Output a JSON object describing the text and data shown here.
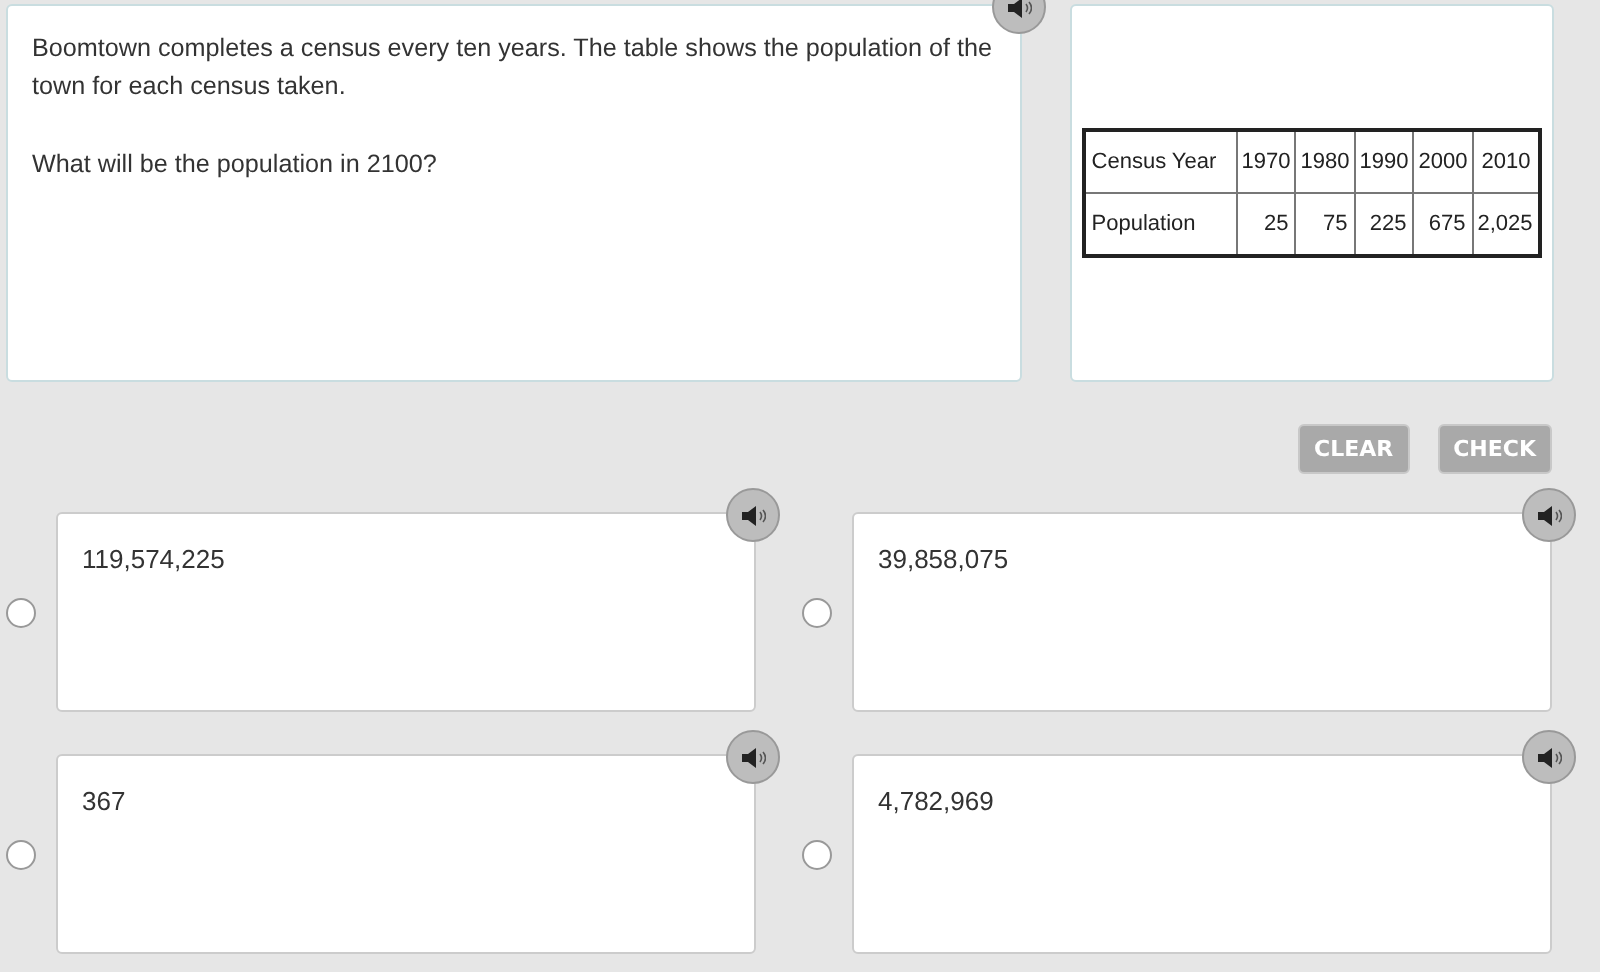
{
  "question": {
    "paragraphs": [
      "Boomtown completes a census every ten years. The table shows the population of the town for each census taken.",
      "What will be the population in 2100?"
    ]
  },
  "table": {
    "rows": [
      {
        "header": "Census Year",
        "cells": [
          "1970",
          "1980",
          "1990",
          "2000",
          "2010"
        ]
      },
      {
        "header": "Population",
        "cells": [
          "25",
          "75",
          "225",
          "675",
          "2,025"
        ]
      }
    ]
  },
  "buttons": [
    {
      "label": "CLEAR",
      "disabled": true
    },
    {
      "label": "CHECK",
      "disabled": true
    }
  ],
  "answers": [
    {
      "text": "119,574,225",
      "selected": false
    },
    {
      "text": "39,858,075",
      "selected": false
    },
    {
      "text": "367",
      "selected": false
    },
    {
      "text": "4,782,969",
      "selected": false
    }
  ]
}
